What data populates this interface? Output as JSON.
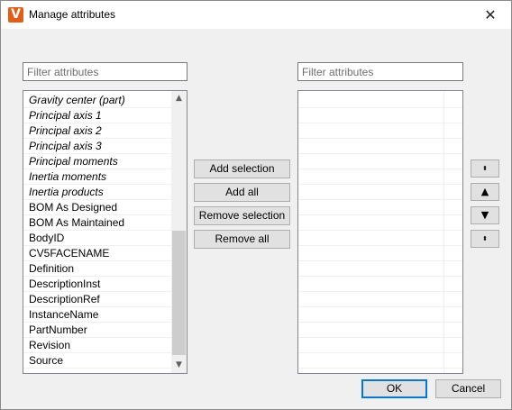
{
  "window": {
    "title": "Manage attributes",
    "close_glyph": "✕",
    "app_icon_letter": "V"
  },
  "left_filter": {
    "placeholder": "Filter attributes",
    "value": ""
  },
  "right_filter": {
    "placeholder": "Filter attributes",
    "value": ""
  },
  "available_attributes": [
    {
      "label": "Gravity center (part)",
      "italic": true
    },
    {
      "label": "Principal axis 1",
      "italic": true
    },
    {
      "label": "Principal axis 2",
      "italic": true
    },
    {
      "label": "Principal axis 3",
      "italic": true
    },
    {
      "label": "Principal moments",
      "italic": true
    },
    {
      "label": "Inertia moments",
      "italic": true
    },
    {
      "label": "Inertia products",
      "italic": true
    },
    {
      "label": "BOM As Designed",
      "italic": false
    },
    {
      "label": "BOM As Maintained",
      "italic": false
    },
    {
      "label": "BodyID",
      "italic": false
    },
    {
      "label": "CV5FACENAME",
      "italic": false
    },
    {
      "label": "Definition",
      "italic": false
    },
    {
      "label": "DescriptionInst",
      "italic": false
    },
    {
      "label": "DescriptionRef",
      "italic": false
    },
    {
      "label": "InstanceName",
      "italic": false
    },
    {
      "label": "PartNumber",
      "italic": false
    },
    {
      "label": "Revision",
      "italic": false
    },
    {
      "label": "Source",
      "italic": false
    }
  ],
  "selected_attributes": [],
  "actions": {
    "add_selection": "Add selection",
    "add_all": "Add all",
    "remove_selection": "Remove selection",
    "remove_all": "Remove all"
  },
  "order_buttons": {
    "move_top": "⬍",
    "move_up": "▲",
    "move_down": "▼",
    "move_bottom": "⬍"
  },
  "scroll_glyphs": {
    "up": "▲",
    "down": "▼"
  },
  "footer": {
    "ok": "OK",
    "cancel": "Cancel"
  },
  "colors": {
    "app_icon": "#e35d14",
    "default_button_border": "#0078d7"
  }
}
